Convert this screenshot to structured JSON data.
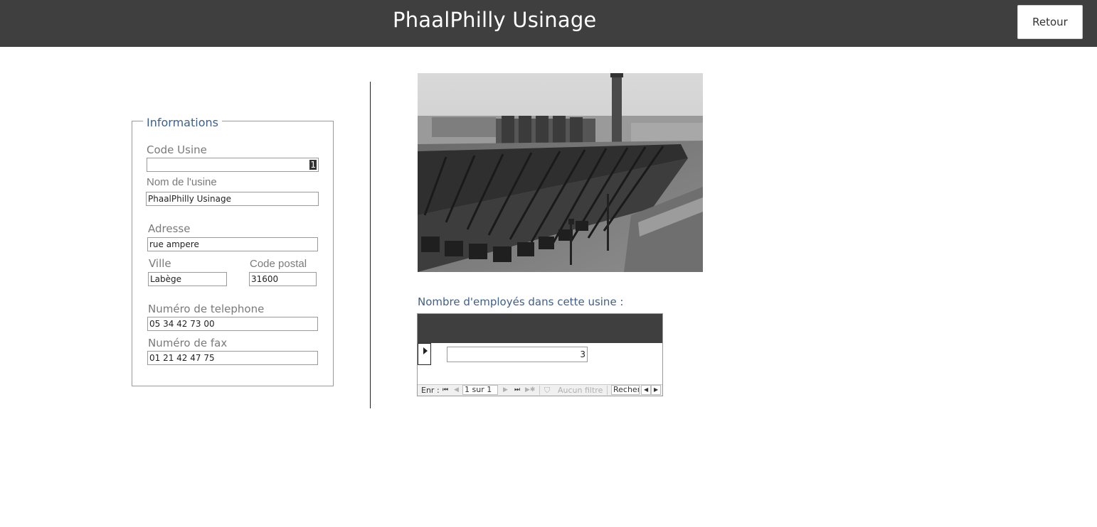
{
  "header": {
    "title": "PhaalPhilly Usinage",
    "back_label": "Retour"
  },
  "info": {
    "legend": "Informations",
    "code_usine_label": "Code Usine",
    "code_usine_value": "1",
    "nom_label": "Nom de l'usine",
    "nom_value": "PhaalPhilly Usinage",
    "adresse_label": "Adresse",
    "adresse_value": "rue ampere",
    "ville_label": "Ville",
    "ville_value": "Labège",
    "code_postal_label": "Code postal",
    "code_postal_value": "31600",
    "telephone_label": "Numéro de telephone",
    "telephone_value": "05 34 42 73 00",
    "fax_label": "Numéro de fax",
    "fax_value": "01 21 42 47 75"
  },
  "employees": {
    "label": "Nombre d'employés dans cette usine :",
    "count": "3"
  },
  "navigation": {
    "record_label": "Enr :",
    "first_icon": "first-record-icon",
    "prev_icon": "previous-record-icon",
    "position": "1 sur 1",
    "next_icon": "next-record-icon",
    "last_icon": "last-record-icon",
    "new_icon": "new-record-icon",
    "filter_icon": "filter-icon",
    "filter_label": "Aucun filtre",
    "search_value": "Recher"
  },
  "colors": {
    "header_bg": "#3f3f3f",
    "accent_text": "#3e5f8a"
  }
}
